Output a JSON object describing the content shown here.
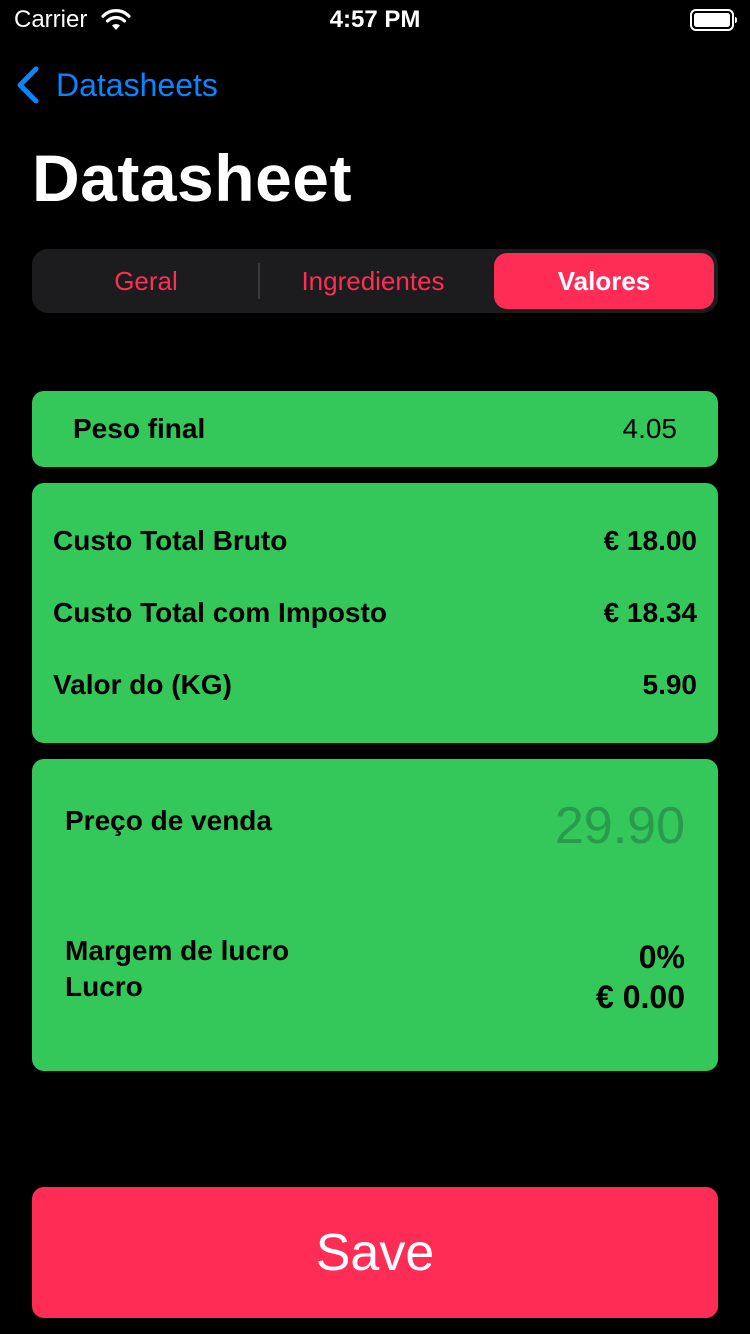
{
  "status_bar": {
    "carrier": "Carrier",
    "time": "4:57 PM",
    "icons": [
      "wifi-icon",
      "battery-icon"
    ]
  },
  "nav": {
    "back_label": "Datasheets",
    "back_icon": "chevron-left-icon",
    "title": "Datasheet"
  },
  "segments": {
    "items": [
      "Geral",
      "Ingredientes",
      "Valores"
    ],
    "selected": "Valores"
  },
  "peso": {
    "label": "Peso final",
    "value": "4.05"
  },
  "custos": {
    "rows": [
      {
        "label": "Custo Total Bruto",
        "value": "€ 18.00"
      },
      {
        "label": "Custo Total com Imposto",
        "value": "€ 18.34"
      },
      {
        "label": "Valor do (KG)",
        "value": "5.90"
      }
    ]
  },
  "venda": {
    "label": "Preço de venda",
    "placeholder": "29.90",
    "margem_label": "Margem de lucro",
    "margem_value": "0%",
    "lucro_label": "Lucro",
    "lucro_value": "€ 0.00"
  },
  "actions": {
    "save_label": "Save"
  },
  "colors": {
    "background": "#000000",
    "accent": "#ff2d55",
    "link": "#0a84ff",
    "card": "#34c759",
    "placeholder": "#2a9b4c",
    "segment_bg": "#1c1c1e"
  }
}
